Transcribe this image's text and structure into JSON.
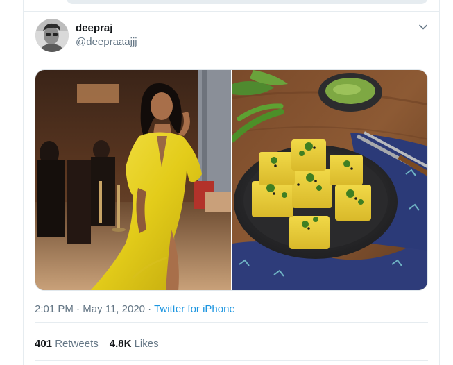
{
  "tweet": {
    "display_name": "deepraj",
    "handle": "@deepraaajjj",
    "time": "2:01 PM",
    "date": "May 11, 2020",
    "separator": "·",
    "source": "Twitter for iPhone",
    "stats": {
      "retweets_count": "401",
      "retweets_label": "Retweets",
      "likes_count": "4.8K",
      "likes_label": "Likes"
    }
  },
  "icons": {
    "menu": "chevron-down-icon"
  },
  "colors": {
    "link_blue": "#1b95e0",
    "muted_gray": "#657786",
    "text_dark": "#14171a",
    "border": "#e6ecf0"
  }
}
